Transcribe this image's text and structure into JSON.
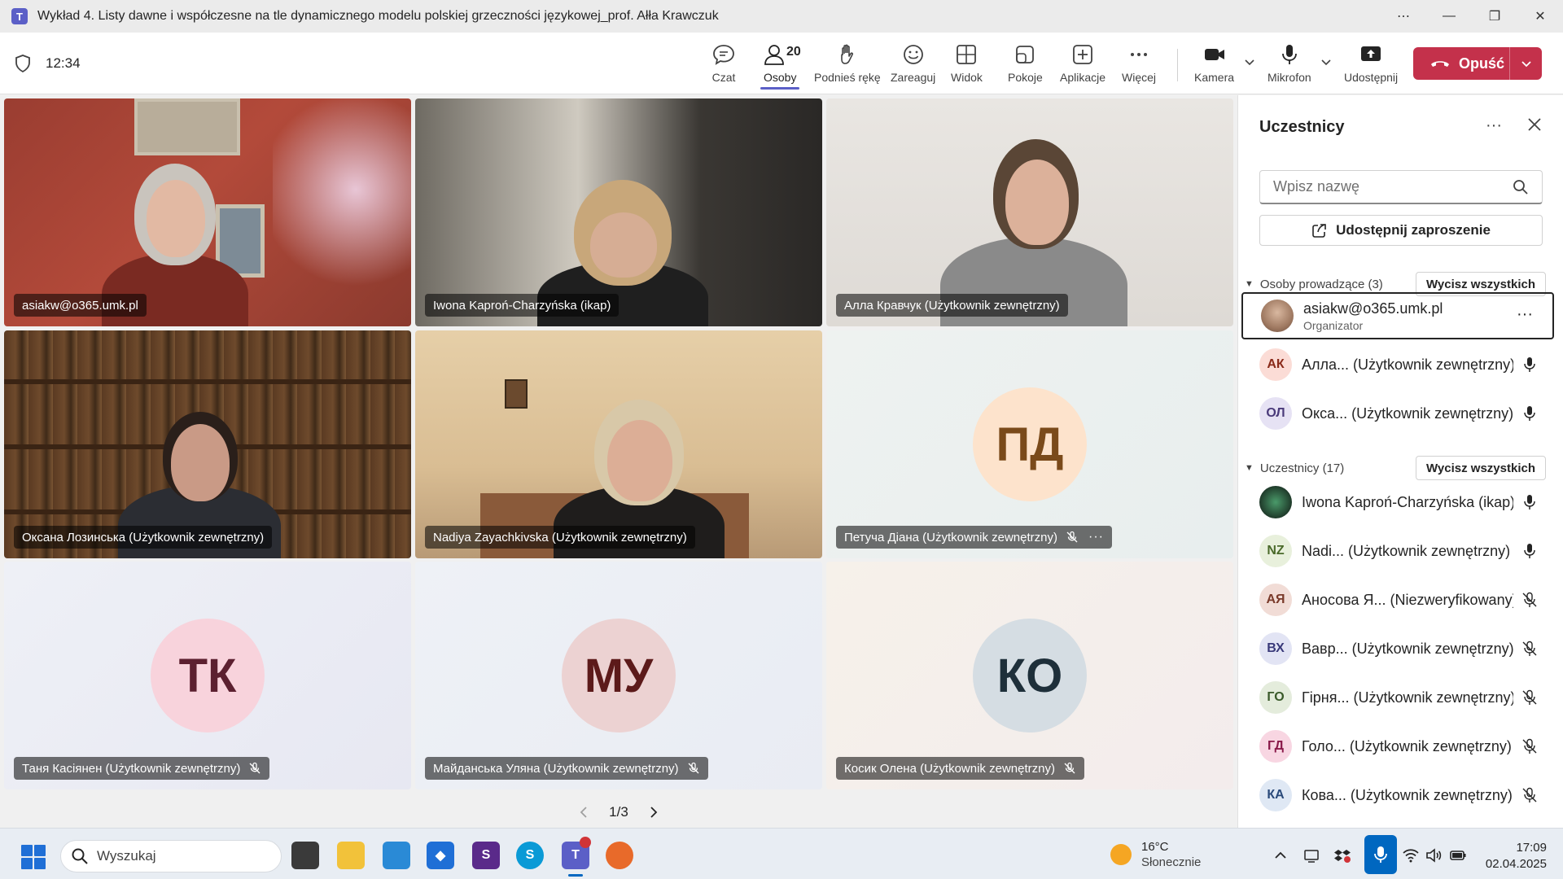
{
  "window": {
    "title": "Wykład 4. Listy dawne i współczesne na tle dynamicznego modelu polskiej grzeczności językowej_prof. Ałła Krawczuk"
  },
  "meeting": {
    "time": "12:34",
    "toolbar": {
      "chat": "Czat",
      "people": "Osoby",
      "people_count": "20",
      "raise_hand": "Podnieś rękę",
      "react": "Zareaguj",
      "view": "Widok",
      "rooms": "Pokoje",
      "apps": "Aplikacje",
      "more": "Więcej",
      "camera": "Kamera",
      "mic": "Mikrofon",
      "share": "Udostępnij",
      "leave": "Opuść"
    }
  },
  "tiles": [
    {
      "name": "asiakw@o365.umk.pl"
    },
    {
      "name": "Iwona Kaproń-Charzyńska (ikap)"
    },
    {
      "name": "Алла Кравчук (Użytkownik zewnętrzny)"
    },
    {
      "name": "Оксана Лозинська (Użytkownik zewnętrzny)"
    },
    {
      "name": "Nadiya Zayachkivska (Użytkownik zewnętrzny)"
    },
    {
      "name": "Петуча Діана (Użytkownik zewnętrzny)",
      "initials": "ПД"
    },
    {
      "name": "Таня Касіянен (Użytkownik zewnętrzny)",
      "initials": "ТК"
    },
    {
      "name": "Майданська Уляна (Użytkownik zewnętrzny)",
      "initials": "МУ"
    },
    {
      "name": "Косик Олена (Użytkownik zewnętrzny)",
      "initials": "КО"
    }
  ],
  "pager": {
    "label": "1/3"
  },
  "panel": {
    "title": "Uczestnicy",
    "search_placeholder": "Wpisz nazwę",
    "share_invite": "Udostępnij zaproszenie",
    "presenters_header": "Osoby prowadzące (3)",
    "attendees_header": "Uczestnicy (17)",
    "mute_all": "Wycisz wszystkich",
    "presenters": [
      {
        "name": "asiakw@o365.umk.pl",
        "role": "Organizator"
      },
      {
        "initials": "АК",
        "name": "Алла... (Użytkownik zewnętrzny)"
      },
      {
        "initials": "ОЛ",
        "name": "Окса... (Użytkownik zewnętrzny)"
      }
    ],
    "attendees": [
      {
        "name": "Iwona Kaproń-Charzyńska (ikap)"
      },
      {
        "initials": "NZ",
        "name": "Nadi... (Użytkownik zewnętrzny)"
      },
      {
        "initials": "АЯ",
        "name": "Аносова Я... (Niezweryfikowany)"
      },
      {
        "initials": "ВХ",
        "name": "Вавр... (Użytkownik zewnętrzny)"
      },
      {
        "initials": "ГО",
        "name": "Гірня... (Użytkownik zewnętrzny)"
      },
      {
        "initials": "ГД",
        "name": "Голо... (Użytkownik zewnętrzny)"
      },
      {
        "initials": "КА",
        "name": "Кова... (Użytkownik zewnętrzny)"
      }
    ]
  },
  "taskbar": {
    "search_placeholder": "Wyszukaj",
    "weather_temp": "16°C",
    "weather_desc": "Słonecznie",
    "clock_time": "17:09",
    "clock_date": "02.04.2025"
  },
  "colors": {
    "accent": "#5b5fc7",
    "leave": "#c4314b"
  }
}
